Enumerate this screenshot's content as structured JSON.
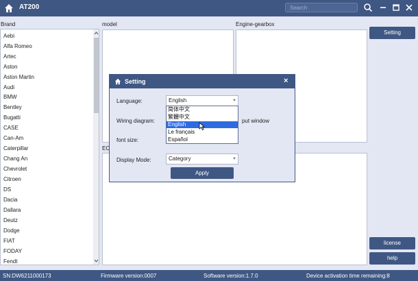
{
  "app": {
    "title": "AT200"
  },
  "search": {
    "placeholder": "Search"
  },
  "panels": {
    "brand_label": "Brand",
    "model_label": "model",
    "engine_label": "Engine-gearbox",
    "ecu_label": "ECU"
  },
  "brands": [
    "Aebi",
    "Alfa Romeo",
    "Artec",
    "Aston",
    "Aston Martin",
    "Audi",
    "BMW",
    "Bentley",
    "Bugatti",
    "CASE",
    "Can-Am",
    "Caterpillar",
    "Chang An",
    "Chevrolet",
    "Citroen",
    "DS",
    "Dacia",
    "Dallara",
    "Deutz",
    "Dodge",
    "FIAT",
    "FODAY",
    "Fendt"
  ],
  "sidebar": {
    "setting": "Setting",
    "license": "license",
    "help": "help"
  },
  "status": {
    "sn": "SN:DW6211000173",
    "firmware": "Firmware version:0007",
    "software": "Software version:1.7.0",
    "activation": "Device activation time remaining:8"
  },
  "dialog": {
    "title": "Setting",
    "language_label": "Language:",
    "language_value": "English",
    "wiring_label": "Wiring diagram:",
    "wiring_value_partial": "put window",
    "font_label": "font size:",
    "display_label": "Display Mode:",
    "display_value": "Category",
    "apply": "Apply",
    "language_options": [
      "简体中文",
      "繁體中文",
      "English",
      "Le français",
      "Español"
    ],
    "selected_option_index": 2
  },
  "colors": {
    "primary": "#3f5783",
    "background": "#e3e7f3",
    "highlight": "#2d6be0"
  }
}
